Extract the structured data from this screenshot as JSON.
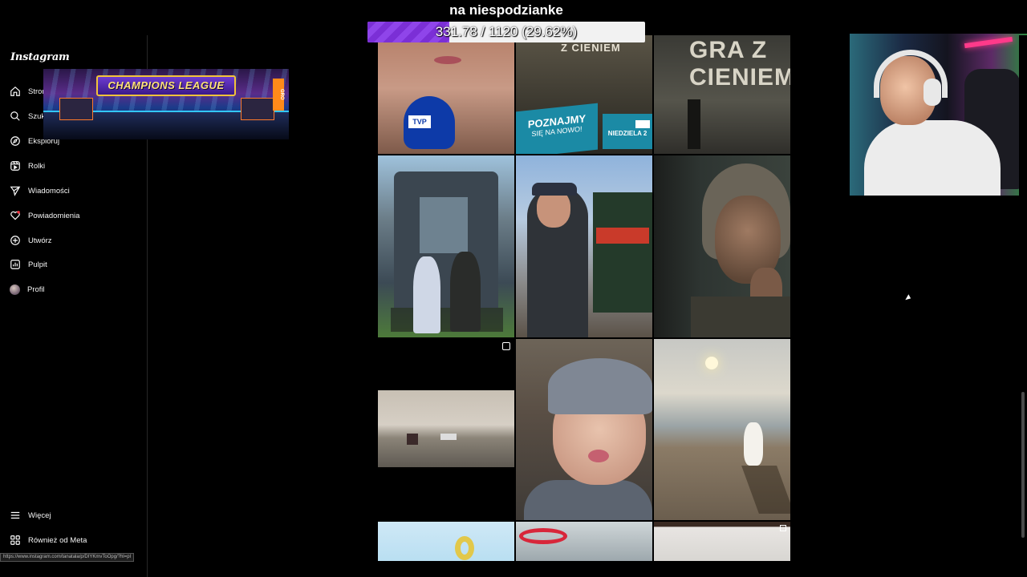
{
  "app": {
    "logo": "Instagram"
  },
  "sidebar": {
    "items": [
      {
        "label": "Strona główna",
        "icon": "home-icon"
      },
      {
        "label": "Szukaj",
        "icon": "search-icon"
      },
      {
        "label": "Eksploruj",
        "icon": "compass-icon"
      },
      {
        "label": "Rolki",
        "icon": "reels-icon"
      },
      {
        "label": "Wiadomości",
        "icon": "send-icon"
      },
      {
        "label": "Powiadomienia",
        "icon": "heart-icon"
      },
      {
        "label": "Utwórz",
        "icon": "plus-square-icon"
      },
      {
        "label": "Pulpit",
        "icon": "dashboard-icon"
      },
      {
        "label": "Profil",
        "icon": "avatar"
      }
    ],
    "bottom_items": [
      {
        "label": "Więcej",
        "icon": "menu-icon"
      },
      {
        "label": "Również od Meta",
        "icon": "meta-icon"
      }
    ]
  },
  "status_bar": {
    "url": "https://www.instagram.com/tanatala/p/DIYKmvToOpg/?hl=pl"
  },
  "overlay": {
    "banner_text": "CHAMPIONS LEAGUE",
    "banner_tag": "GRO",
    "goal_title": "na niespodzianke",
    "goal_text": "331.78 / 1120 (29.62%)",
    "goal_fraction": 0.2962,
    "goal_color": "#7b2fd6"
  },
  "grid": {
    "tiles": [
      {
        "row": 0,
        "col": 0,
        "mic_label": "TVP"
      },
      {
        "row": 0,
        "col": 1,
        "title": "Z CIENIEM",
        "promo": "POZNAJMY",
        "promo_sub": "SIĘ NA NOWO!",
        "date": "NIEDZIELA 2"
      },
      {
        "row": 0,
        "col": 2,
        "title": "GRA Z CIENIEM"
      },
      {
        "row": 1,
        "col": 0
      },
      {
        "row": 1,
        "col": 1
      },
      {
        "row": 1,
        "col": 2
      },
      {
        "row": 2,
        "col": 0,
        "badge": "reel-icon"
      },
      {
        "row": 2,
        "col": 1
      },
      {
        "row": 2,
        "col": 2
      },
      {
        "row": 3,
        "col": 0
      },
      {
        "row": 3,
        "col": 1
      },
      {
        "row": 3,
        "col": 2,
        "badge": "multi-post-icon"
      }
    ]
  }
}
